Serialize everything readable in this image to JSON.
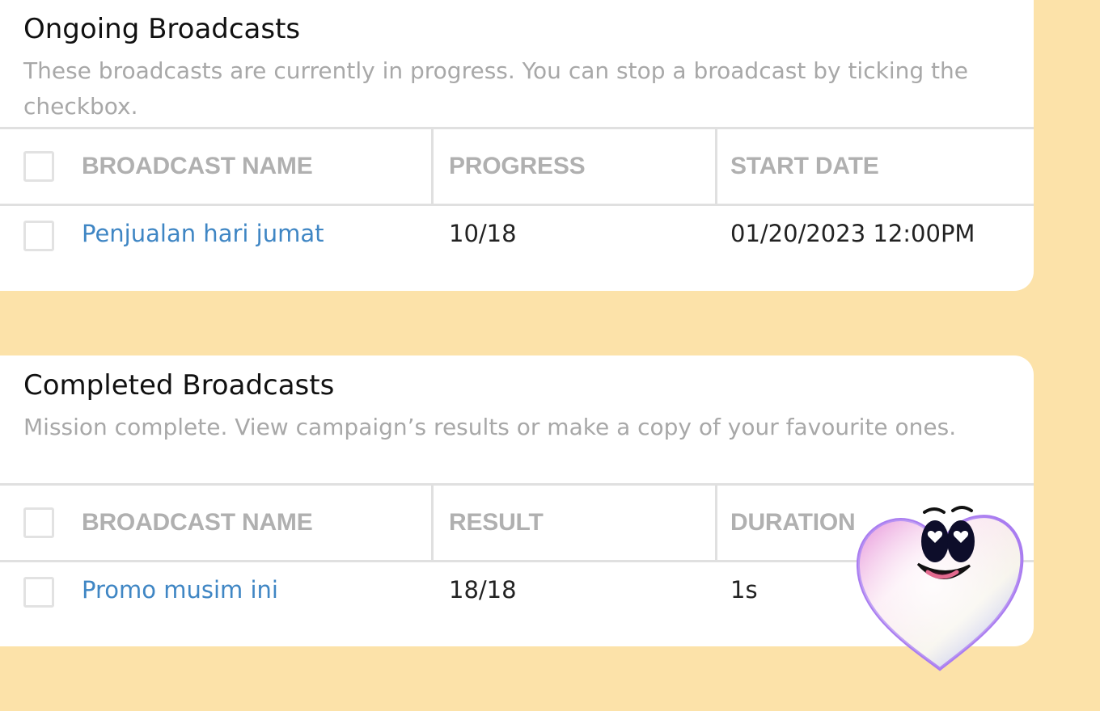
{
  "ongoing": {
    "title": "Ongoing Broadcasts",
    "description": "These broadcasts are currently in progress. You can stop a broadcast by ticking the checkbox.",
    "columns": [
      "BROADCAST NAME",
      "PROGRESS",
      "START DATE"
    ],
    "rows": [
      {
        "name": "Penjualan hari jumat",
        "progress": "10/18",
        "start_date": "01/20/2023 12:00PM"
      }
    ]
  },
  "completed": {
    "title": "Completed Broadcasts",
    "description": "Mission complete. View campaign’s results or make a copy of your favourite ones.",
    "columns": [
      "BROADCAST NAME",
      "RESULT",
      "DURATION"
    ],
    "rows": [
      {
        "name": "Promo musim ini",
        "result": "18/18",
        "duration": "1s"
      }
    ]
  },
  "colors": {
    "background": "#fce2a9",
    "card": "#ffffff",
    "link": "#3f86c4",
    "header_text": "#b0b0b0",
    "muted_text": "#a8a8a8"
  },
  "icons": [
    "checkbox-icon",
    "heart-mascot-icon"
  ]
}
